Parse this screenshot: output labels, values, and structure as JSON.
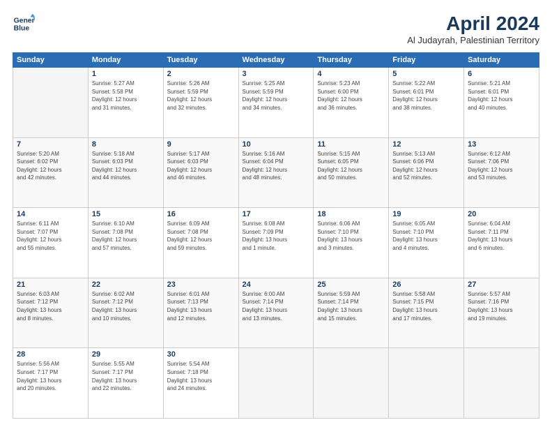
{
  "logo": {
    "line1": "General",
    "line2": "Blue"
  },
  "title": "April 2024",
  "subtitle": "Al Judayrah, Palestinian Territory",
  "header_days": [
    "Sunday",
    "Monday",
    "Tuesday",
    "Wednesday",
    "Thursday",
    "Friday",
    "Saturday"
  ],
  "weeks": [
    [
      {
        "day": "",
        "info": ""
      },
      {
        "day": "1",
        "info": "Sunrise: 5:27 AM\nSunset: 5:58 PM\nDaylight: 12 hours\nand 31 minutes."
      },
      {
        "day": "2",
        "info": "Sunrise: 5:26 AM\nSunset: 5:59 PM\nDaylight: 12 hours\nand 32 minutes."
      },
      {
        "day": "3",
        "info": "Sunrise: 5:25 AM\nSunset: 5:59 PM\nDaylight: 12 hours\nand 34 minutes."
      },
      {
        "day": "4",
        "info": "Sunrise: 5:23 AM\nSunset: 6:00 PM\nDaylight: 12 hours\nand 36 minutes."
      },
      {
        "day": "5",
        "info": "Sunrise: 5:22 AM\nSunset: 6:01 PM\nDaylight: 12 hours\nand 38 minutes."
      },
      {
        "day": "6",
        "info": "Sunrise: 5:21 AM\nSunset: 6:01 PM\nDaylight: 12 hours\nand 40 minutes."
      }
    ],
    [
      {
        "day": "7",
        "info": "Sunrise: 5:20 AM\nSunset: 6:02 PM\nDaylight: 12 hours\nand 42 minutes."
      },
      {
        "day": "8",
        "info": "Sunrise: 5:18 AM\nSunset: 6:03 PM\nDaylight: 12 hours\nand 44 minutes."
      },
      {
        "day": "9",
        "info": "Sunrise: 5:17 AM\nSunset: 6:03 PM\nDaylight: 12 hours\nand 46 minutes."
      },
      {
        "day": "10",
        "info": "Sunrise: 5:16 AM\nSunset: 6:04 PM\nDaylight: 12 hours\nand 48 minutes."
      },
      {
        "day": "11",
        "info": "Sunrise: 5:15 AM\nSunset: 6:05 PM\nDaylight: 12 hours\nand 50 minutes."
      },
      {
        "day": "12",
        "info": "Sunrise: 5:13 AM\nSunset: 6:06 PM\nDaylight: 12 hours\nand 52 minutes."
      },
      {
        "day": "13",
        "info": "Sunrise: 6:12 AM\nSunset: 7:06 PM\nDaylight: 12 hours\nand 53 minutes."
      }
    ],
    [
      {
        "day": "14",
        "info": "Sunrise: 6:11 AM\nSunset: 7:07 PM\nDaylight: 12 hours\nand 55 minutes."
      },
      {
        "day": "15",
        "info": "Sunrise: 6:10 AM\nSunset: 7:08 PM\nDaylight: 12 hours\nand 57 minutes."
      },
      {
        "day": "16",
        "info": "Sunrise: 6:09 AM\nSunset: 7:08 PM\nDaylight: 12 hours\nand 59 minutes."
      },
      {
        "day": "17",
        "info": "Sunrise: 6:08 AM\nSunset: 7:09 PM\nDaylight: 13 hours\nand 1 minute."
      },
      {
        "day": "18",
        "info": "Sunrise: 6:06 AM\nSunset: 7:10 PM\nDaylight: 13 hours\nand 3 minutes."
      },
      {
        "day": "19",
        "info": "Sunrise: 6:05 AM\nSunset: 7:10 PM\nDaylight: 13 hours\nand 4 minutes."
      },
      {
        "day": "20",
        "info": "Sunrise: 6:04 AM\nSunset: 7:11 PM\nDaylight: 13 hours\nand 6 minutes."
      }
    ],
    [
      {
        "day": "21",
        "info": "Sunrise: 6:03 AM\nSunset: 7:12 PM\nDaylight: 13 hours\nand 8 minutes."
      },
      {
        "day": "22",
        "info": "Sunrise: 6:02 AM\nSunset: 7:12 PM\nDaylight: 13 hours\nand 10 minutes."
      },
      {
        "day": "23",
        "info": "Sunrise: 6:01 AM\nSunset: 7:13 PM\nDaylight: 13 hours\nand 12 minutes."
      },
      {
        "day": "24",
        "info": "Sunrise: 6:00 AM\nSunset: 7:14 PM\nDaylight: 13 hours\nand 13 minutes."
      },
      {
        "day": "25",
        "info": "Sunrise: 5:59 AM\nSunset: 7:14 PM\nDaylight: 13 hours\nand 15 minutes."
      },
      {
        "day": "26",
        "info": "Sunrise: 5:58 AM\nSunset: 7:15 PM\nDaylight: 13 hours\nand 17 minutes."
      },
      {
        "day": "27",
        "info": "Sunrise: 5:57 AM\nSunset: 7:16 PM\nDaylight: 13 hours\nand 19 minutes."
      }
    ],
    [
      {
        "day": "28",
        "info": "Sunrise: 5:56 AM\nSunset: 7:17 PM\nDaylight: 13 hours\nand 20 minutes."
      },
      {
        "day": "29",
        "info": "Sunrise: 5:55 AM\nSunset: 7:17 PM\nDaylight: 13 hours\nand 22 minutes."
      },
      {
        "day": "30",
        "info": "Sunrise: 5:54 AM\nSunset: 7:18 PM\nDaylight: 13 hours\nand 24 minutes."
      },
      {
        "day": "",
        "info": ""
      },
      {
        "day": "",
        "info": ""
      },
      {
        "day": "",
        "info": ""
      },
      {
        "day": "",
        "info": ""
      }
    ]
  ]
}
